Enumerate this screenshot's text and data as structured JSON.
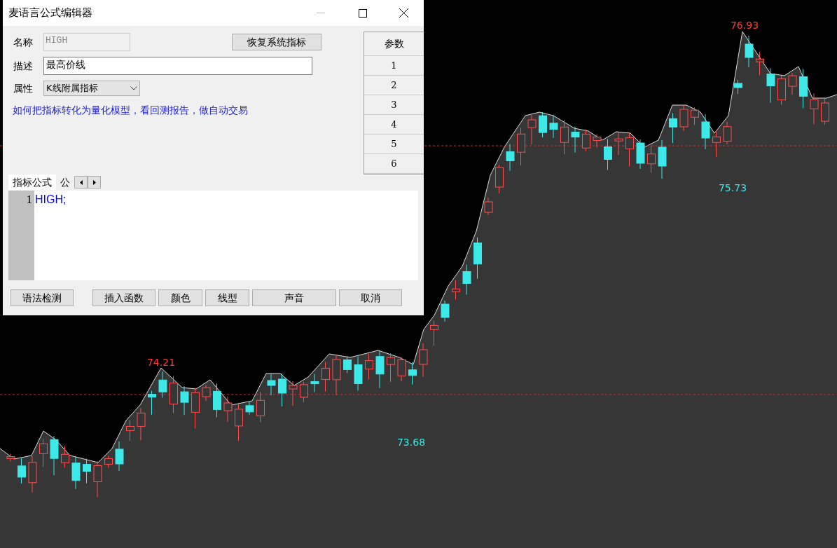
{
  "window": {
    "title": "麦语言公式编辑器"
  },
  "form": {
    "name": {
      "label": "名称",
      "value": "HIGH",
      "disabled": true
    },
    "restore_button": "恢复系统指标",
    "description": {
      "label": "描述",
      "value": "最高价线"
    },
    "attribute": {
      "label": "属性",
      "value": "K线附属指标"
    },
    "help_link": "如何把指标转化为量化模型，看回测报告，做自动交易"
  },
  "params": {
    "header": "参数",
    "rows": [
      "1",
      "2",
      "3",
      "4",
      "5",
      "6"
    ]
  },
  "editor_tabs": [
    {
      "label": "指标公式",
      "selected": true
    },
    {
      "label": "公",
      "selected": false
    }
  ],
  "editor": {
    "lines": [
      {
        "number": "1",
        "code": "HIGH;"
      }
    ]
  },
  "buttons": [
    "语法检测",
    "插入函数",
    "颜色",
    "线型",
    "声音",
    "取消"
  ],
  "chart": {
    "labels": [
      {
        "text": "76.93",
        "kind": "high"
      },
      {
        "text": "75.73",
        "kind": "low"
      },
      {
        "text": "74.21",
        "kind": "high"
      },
      {
        "text": "73.68",
        "kind": "low"
      }
    ]
  }
}
